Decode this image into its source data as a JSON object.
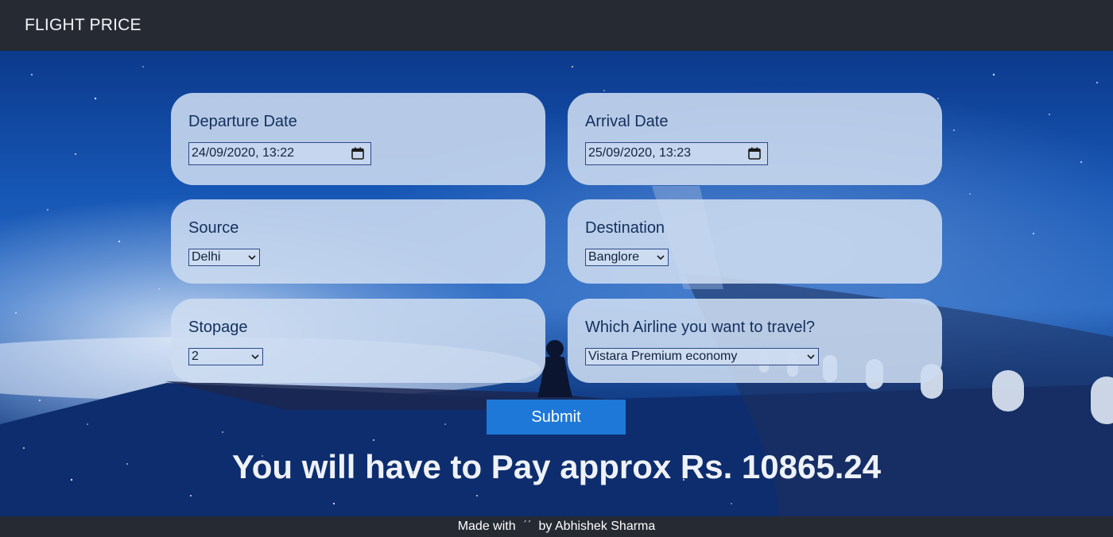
{
  "navbar": {
    "brand": "FLIGHT PRICE"
  },
  "form": {
    "departure": {
      "label": "Departure Date",
      "value": "24/09/2020, 13:22"
    },
    "arrival": {
      "label": "Arrival Date",
      "value": "25/09/2020, 13:23"
    },
    "source": {
      "label": "Source",
      "selected": "Delhi"
    },
    "destination": {
      "label": "Destination",
      "selected": "Banglore"
    },
    "stopage": {
      "label": "Stopage",
      "selected": "2"
    },
    "airline": {
      "label": "Which Airline you want to travel?",
      "selected": "Vistara Premium economy"
    },
    "submit_label": "Submit"
  },
  "result": {
    "text": "You will have to Pay approx Rs. 10865.24"
  },
  "footer": {
    "prefix": "Made with",
    "heart_symbol": "ˊˊ",
    "suffix": "by Abhishek Sharma"
  },
  "icons": {
    "calendar": "calendar-icon",
    "dropdown": "chevron-down-icon",
    "heart": "heart-icon"
  },
  "colors": {
    "navbar": "#262a33",
    "submit": "#1e78d8",
    "card": "#cddcf0",
    "text_dark": "#14305c"
  }
}
